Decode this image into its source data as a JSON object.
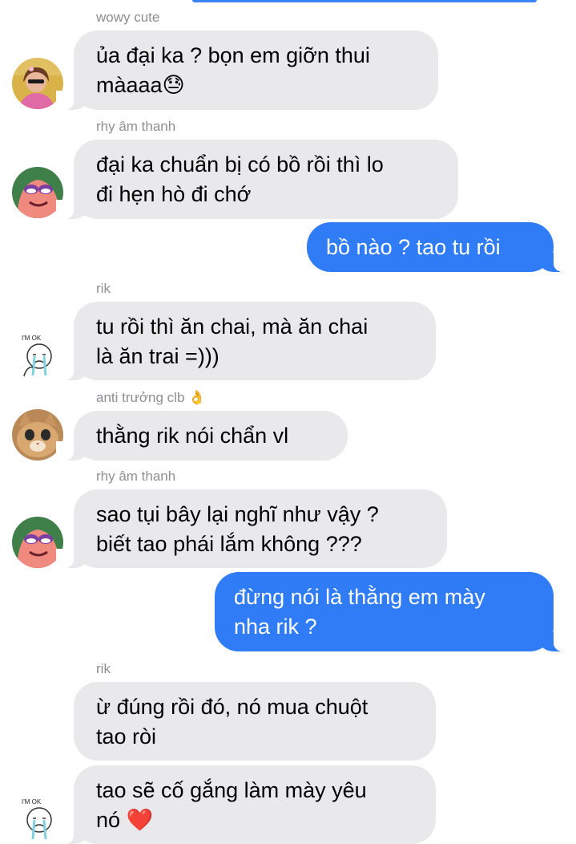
{
  "chat": {
    "messages": [
      {
        "sender": "wowy cute",
        "text": "ủa đại ka ? bọn em giỡn thui\nmàaaa😓",
        "avatar": "girl-photo-avatar"
      },
      {
        "sender": "rhy âm thanh",
        "text": "đại ka chuẩn bị có bồ rồi thì lo\nđi hẹn hò đi chớ",
        "avatar": "patrick-star-avatar"
      },
      {
        "text": "bồ nào ? tao tu rồi"
      },
      {
        "sender": "rik",
        "text": "tu rồi thì ăn chai, mà ăn chai\nlà ăn trai =)))",
        "avatar": "im-ok-crying-avatar"
      },
      {
        "sender": "anti trưởng clb 👌",
        "text": "thằng rik nói chẩn vl",
        "avatar": "cat-avatar"
      },
      {
        "sender": "rhy âm thanh",
        "text": "sao tụi bây lại nghĩ như vậy ?\nbiết tao phái lắm không ???",
        "avatar": "patrick-star-avatar"
      },
      {
        "text": "đừng nói là thằng em mày\nnha rik ?"
      },
      {
        "sender": "rik",
        "text": "ừ đúng rồi đó, nó mua chuột\ntao ròi"
      },
      {
        "text": "tao sẽ cố gắng làm mày yêu\nnó ❤️",
        "avatar": "im-ok-crying-avatar"
      }
    ]
  },
  "colors": {
    "incoming_bubble": "#e9e9eb",
    "outgoing_bubble": "#2f7cf6",
    "sender_label": "#8e8e93"
  }
}
